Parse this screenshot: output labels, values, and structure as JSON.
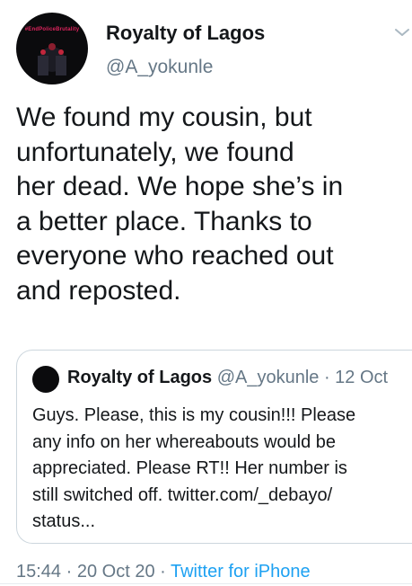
{
  "author": {
    "name": "Royalty of Lagos",
    "handle": "@A_yokunle",
    "avatar_text": "#EndPoliceBrutality"
  },
  "tweet": {
    "lines": [
      "We found my cousin, but",
      "unfortunately, we found",
      "her dead. We hope she’s in",
      "a better place. Thanks to",
      "everyone who reached out",
      "and reposted."
    ]
  },
  "quoted": {
    "name": "Royalty of Lagos",
    "meta": "@A_yokunle · 12 Oct",
    "lines": [
      "Guys. Please, this is my cousin!!! Please",
      "any info on her whereabouts would be",
      "appreciated. Please RT!! Her number is",
      "still switched off. twitter.com/_debayo/",
      "status..."
    ]
  },
  "footer": {
    "time": "15:44",
    "date": "20 Oct 20",
    "source": "Twitter for iPhone"
  },
  "colors": {
    "text": "#14171a",
    "secondary": "#657786",
    "link": "#1da1f2",
    "border": "#ccd6dd"
  },
  "icons": {
    "menu": "chevron-down-icon"
  }
}
